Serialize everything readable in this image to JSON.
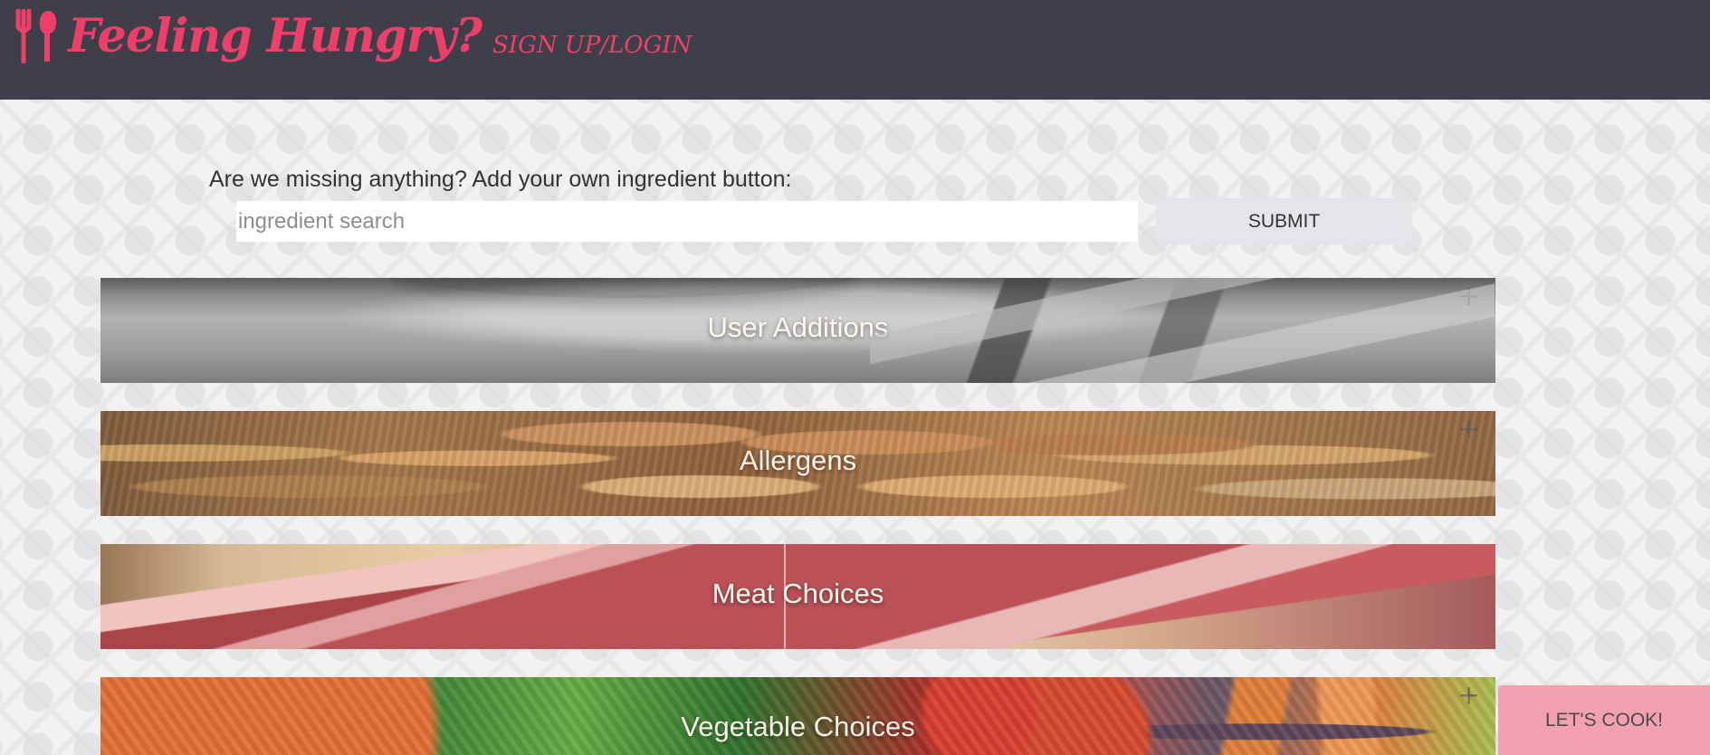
{
  "header": {
    "title": "Feeling Hungry?",
    "login_label": "SIGN UP/LOGIN",
    "brand_icon": "fork-and-spoon-icon",
    "brand_color": "#ef3f68",
    "background_color": "#3f3f4a"
  },
  "search": {
    "prompt": "Are we missing anything? Add your own ingredient button:",
    "placeholder": "ingredient search",
    "value": "",
    "submit_label": "SUBMIT"
  },
  "categories": [
    {
      "label": "User Additions",
      "icon": "plus-icon",
      "expand_symbol": "+"
    },
    {
      "label": "Allergens",
      "icon": "plus-icon",
      "expand_symbol": "+"
    },
    {
      "label": "Meat Choices",
      "icon": "",
      "expand_symbol": ""
    },
    {
      "label": "Vegetable Choices",
      "icon": "plus-icon",
      "expand_symbol": "+"
    }
  ],
  "actions": {
    "lets_cook_label": "LET'S COOK!",
    "lets_cook_color": "#f3a1b2"
  }
}
